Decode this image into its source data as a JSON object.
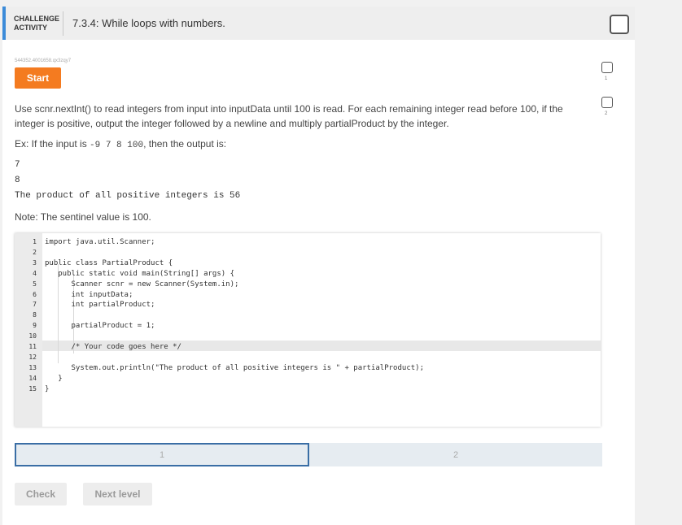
{
  "header": {
    "activity_label_line1": "CHALLENGE",
    "activity_label_line2": "ACTIVITY",
    "title": "7.3.4: While loops with numbers."
  },
  "activity_id": "544352.4001658.qx3zqy7",
  "start_label": "Start",
  "side_levels": [
    "1",
    "2"
  ],
  "prompt": {
    "line1": "Use scnr.nextInt() to read integers from input into inputData until 100 is read. For each remaining integer read before 100, if the",
    "line2": "integer is positive, output the integer followed by a newline and multiply partialProduct by the integer."
  },
  "example": {
    "prefix": "Ex: If the input is ",
    "input": "-9 7 8 100",
    "suffix": ", then the output is:"
  },
  "output_lines": [
    "7",
    "8",
    "The product of all positive integers is 56"
  ],
  "note": "Note: The sentinel value is 100.",
  "code": {
    "line_numbers": [
      "1",
      "2",
      "3",
      "4",
      "5",
      "6",
      "7",
      "8",
      "9",
      "10",
      "11",
      "12",
      "13",
      "14",
      "15"
    ],
    "lines": [
      "import java.util.Scanner;",
      "",
      "public class PartialProduct {",
      "   public static void main(String[] args) {",
      "      Scanner scnr = new Scanner(System.in);",
      "      int inputData;",
      "      int partialProduct;",
      "",
      "      partialProduct = 1;",
      "",
      "      /* Your code goes here */",
      "",
      "      System.out.println(\"The product of all positive integers is \" + partialProduct);",
      "   }",
      "}"
    ]
  },
  "levels": [
    "1",
    "2"
  ],
  "check_label": "Check",
  "next_label": "Next level",
  "colors": {
    "accent": "#3c8bd9",
    "start_button": "#f47b20",
    "level_border": "#3a6ea5"
  }
}
